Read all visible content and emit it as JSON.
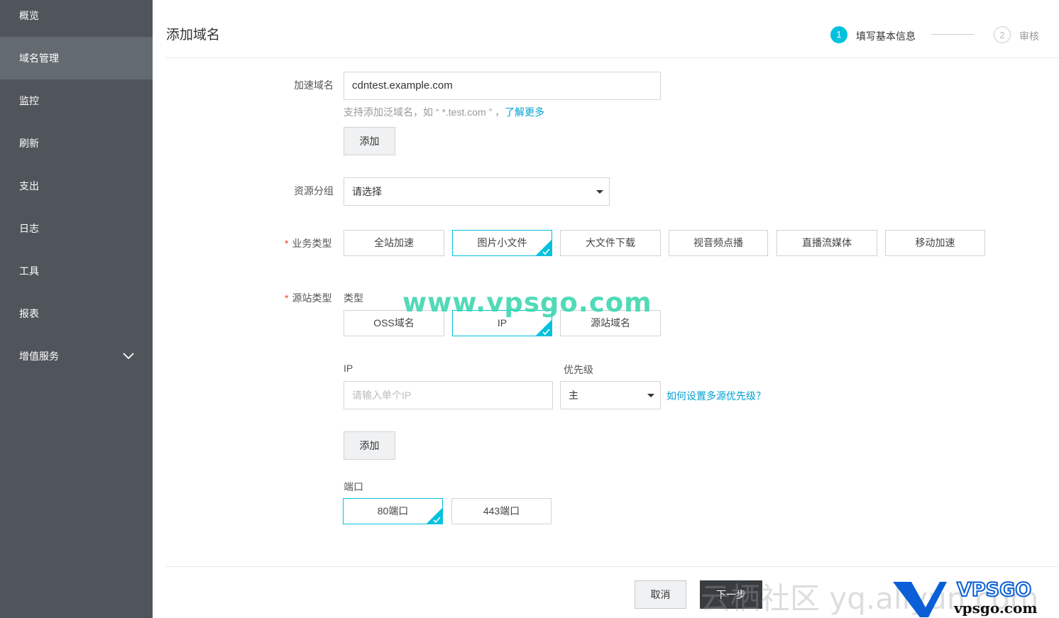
{
  "sidebar": {
    "items": [
      {
        "label": "概览"
      },
      {
        "label": "域名管理",
        "active": true
      },
      {
        "label": "监控"
      },
      {
        "label": "刷新"
      },
      {
        "label": "支出"
      },
      {
        "label": "日志"
      },
      {
        "label": "工具"
      },
      {
        "label": "报表"
      },
      {
        "label": "增值服务",
        "icon": "chevron-down-icon"
      }
    ]
  },
  "header": {
    "title": "添加域名",
    "steps": [
      {
        "number": "1",
        "label": "填写基本信息",
        "active": true
      },
      {
        "number": "2",
        "label": "审核",
        "active": false
      }
    ]
  },
  "form": {
    "domain": {
      "label": "加速域名",
      "value": "cdntest.example.com",
      "hint_prefix": "支持添加泛域名，如 “ *.test.com ” ，",
      "hint_link": "了解更多",
      "add_button": "添加"
    },
    "resource_group": {
      "label": "资源分组",
      "selected": "请选择"
    },
    "business_type": {
      "required_mark": "*",
      "label": "业务类型",
      "options": [
        "全站加速",
        "图片小文件",
        "大文件下载",
        "视音频点播",
        "直播流媒体",
        "移动加速"
      ],
      "selected": "图片小文件"
    },
    "origin_type": {
      "required_mark": "*",
      "label": "源站类型",
      "type_label": "类型",
      "options": [
        "OSS域名",
        "IP",
        "源站域名"
      ],
      "selected": "IP",
      "ip_label": "IP",
      "ip_placeholder": "请输入单个IP",
      "priority_label": "优先级",
      "priority_selected": "主",
      "priority_help_link": "如何设置多源优先级？",
      "add_button": "添加"
    },
    "port": {
      "label": "端口",
      "options": [
        "80端口",
        "443端口"
      ],
      "selected": "80端口"
    }
  },
  "footer": {
    "cancel_label": "取消",
    "next_label": "下一步"
  },
  "watermarks": {
    "center": "www.vpsgo.com",
    "bottom": "云栖社区 yq.aliyun.com",
    "logo_big": "VPSGO",
    "logo_small": "vpsgo.com"
  },
  "colors": {
    "accent": "#00c1de",
    "sidebar_bg": "#50555b",
    "sidebar_active": "#636a70",
    "link": "#00a2d2",
    "required": "#e2402e",
    "watermark_green": "#3fd6b0",
    "logo_blue": "#0a5fd6"
  }
}
